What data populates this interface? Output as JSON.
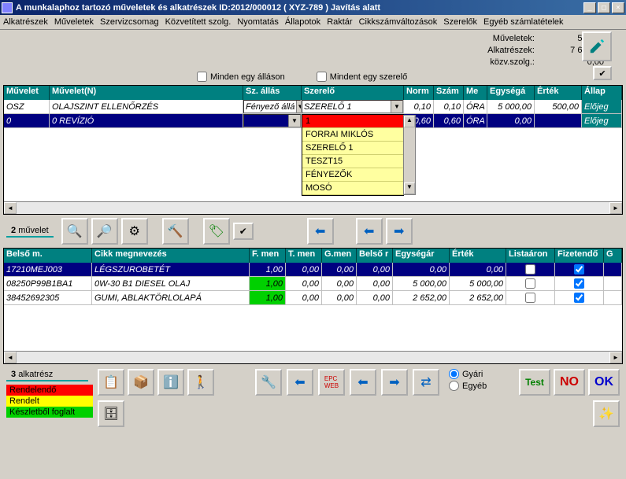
{
  "title": "A munkalaphoz tartozó műveletek és alkatrészek   ID:2012/000012 ( XYZ-789 )   Javítás alatt",
  "menu": [
    "Alkatrészek",
    "Műveletek",
    "Szervizcsomag",
    "Közvetített szolg.",
    "Nyomtatás",
    "Állapotok",
    "Raktár",
    "Cikkszámváltozások",
    "Szerelők",
    "Egyéb számlatételek"
  ],
  "summary": {
    "muveletek_label": "Műveletek:",
    "muveletek_val": "500,00",
    "alkatreszek_label": "Alkatrészek:",
    "alkatreszek_val": "7 652,00",
    "kozv_label": "közv.szolg.:",
    "kozv_val": "0,00"
  },
  "checks": {
    "minden_allason": "Minden egy álláson",
    "mindent_szerelo": "Mindent egy szerelő"
  },
  "ops_header": [
    "Művelet",
    "Művelet(N)",
    "Sz. állás",
    "Szerelő",
    "Norm",
    "Szám",
    "Me",
    "Egységá",
    "Érték",
    "Állap"
  ],
  "ops_rows": [
    {
      "code": "OSZ",
      "name": "OLAJSZINT ELLENŐRZÉS",
      "allas": "Fényező állá",
      "szerelo": "SZERELŐ 1",
      "norm": "0,10",
      "szam": "0,10",
      "me": "ÓRA",
      "egysegar": "5 000,00",
      "ertek": "500,00",
      "allapot": "Előjeg"
    },
    {
      "code": "0",
      "name": "0 REVÍZIÓ",
      "allas": "",
      "szerelo": "1",
      "norm": "0,60",
      "szam": "0,60",
      "me": "ÓRA",
      "egysegar": "0,00",
      "ertek": "",
      "allapot": "Előjeg"
    }
  ],
  "dropdown_items": [
    "1",
    "FORRAI MIKLÓS",
    "SZERELŐ 1",
    "TESZT15",
    "FÉNYEZŐK",
    "MOSÓ"
  ],
  "ops_count_label": "művelet",
  "ops_count": "2",
  "parts_header": [
    "Belső m.",
    "Cikk megnevezés",
    "F. men",
    "T. men",
    "G.men",
    "Belső r",
    "Egységár",
    "Érték",
    "Listaáron",
    "Fizetendő",
    "G"
  ],
  "parts_rows": [
    {
      "code": "17210MEJ003",
      "name": "LÉGSZUROBETÉT",
      "f": "1,00",
      "t": "0,00",
      "g": "0,00",
      "b": "0,00",
      "ar": "0,00",
      "ertek": "0,00",
      "lista": false,
      "fiz": true
    },
    {
      "code": "08250P99B1BA1",
      "name": "0W-30 B1 DIESEL OLAJ",
      "f": "1,00",
      "t": "0,00",
      "g": "0,00",
      "b": "0,00",
      "ar": "5 000,00",
      "ertek": "5 000,00",
      "lista": false,
      "fiz": true
    },
    {
      "code": "38452692305",
      "name": "GUMI, ABLAKTÖRLOLAPÁ",
      "f": "1,00",
      "t": "0,00",
      "g": "0,00",
      "b": "0,00",
      "ar": "2 652,00",
      "ertek": "2 652,00",
      "lista": false,
      "fiz": true
    }
  ],
  "parts_count": "3",
  "parts_count_label": "alkatrész",
  "radios": {
    "gyari": "Gyári",
    "egyeb": "Egyéb"
  },
  "statuses": {
    "rendelendo": "Rendelendő",
    "rendelt": "Rendelt",
    "keszlet": "Készletből foglalt"
  },
  "buttons": {
    "test": "Test",
    "no": "NO",
    "ok": "OK"
  }
}
